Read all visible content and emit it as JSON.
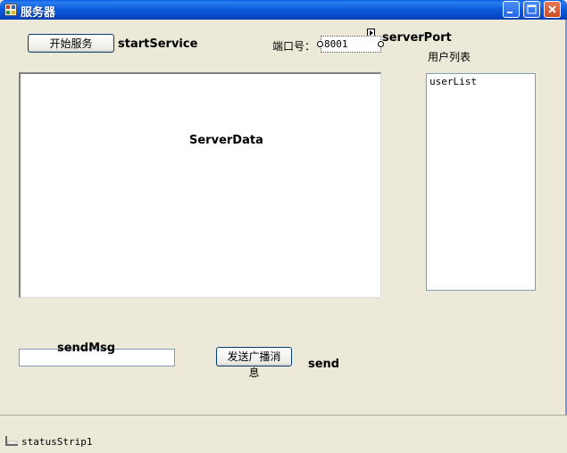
{
  "window": {
    "title": "服务器",
    "icons": {
      "app": "app-icon",
      "minimize": "minimize-icon",
      "maximize": "maximize-icon",
      "close": "close-icon"
    }
  },
  "controls": {
    "start_button_label": "开始服务",
    "start_service_name": "startService",
    "port_label": "端口号：",
    "port_value": "8001",
    "server_port_name": "serverPort",
    "user_list_label": "用户列表",
    "user_list_name": "userList",
    "server_data_name": "ServerData",
    "send_msg_name": "sendMsg",
    "send_msg_value": "",
    "broadcast_button_label": "发送广播消息",
    "send_name": "send"
  },
  "status": {
    "strip_name": "statusStrip1",
    "icon": "status-strip-icon"
  },
  "colors": {
    "titlebar": "#0a5ad9",
    "window_bg": "#ece9d8",
    "close_button": "#c94a23"
  }
}
